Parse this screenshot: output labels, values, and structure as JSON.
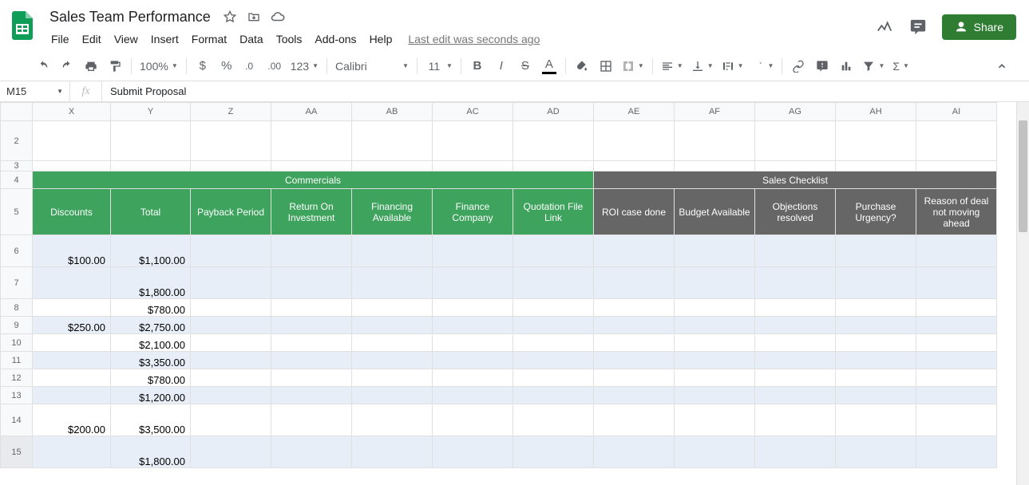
{
  "header": {
    "doc_title": "Sales Team Performance",
    "menus": [
      "File",
      "Edit",
      "View",
      "Insert",
      "Format",
      "Data",
      "Tools",
      "Add-ons",
      "Help"
    ],
    "last_edit": "Last edit was seconds ago",
    "share_label": "Share"
  },
  "toolbar": {
    "zoom": "100%",
    "font_name": "Calibri",
    "font_size": "11",
    "number_fmt": "123"
  },
  "formula_bar": {
    "name_box": "M15",
    "formula": "Submit Proposal"
  },
  "columns": [
    "X",
    "Y",
    "Z",
    "AA",
    "AB",
    "AC",
    "AD",
    "AE",
    "AF",
    "AG",
    "AH",
    "AI"
  ],
  "row_numbers": [
    "2",
    "3",
    "4",
    "5",
    "6",
    "7",
    "8",
    "9",
    "10",
    "11",
    "12",
    "13",
    "14",
    "15"
  ],
  "section_headers": {
    "commercials": "Commercials",
    "sales_checklist": "Sales Checklist"
  },
  "sub_headers_green": [
    "Discounts",
    "Total",
    "Payback Period",
    "Return On Investment",
    "Financing Available",
    "Finance Company",
    "Quotation File Link"
  ],
  "sub_headers_gray": [
    "ROI case done",
    "Budget Available",
    "Objections resolved",
    "Purchase Urgency?",
    "Reason of deal not moving ahead"
  ],
  "rows": [
    {
      "discount": "$100.00",
      "total": "$1,100.00",
      "alt": true,
      "tall": true
    },
    {
      "discount": "",
      "total": "$1,800.00",
      "alt": true,
      "tall": true
    },
    {
      "discount": "",
      "total": "$780.00",
      "alt": false,
      "tall": false
    },
    {
      "discount": "$250.00",
      "total": "$2,750.00",
      "alt": true,
      "tall": false
    },
    {
      "discount": "",
      "total": "$2,100.00",
      "alt": false,
      "tall": false
    },
    {
      "discount": "",
      "total": "$3,350.00",
      "alt": true,
      "tall": false
    },
    {
      "discount": "",
      "total": "$780.00",
      "alt": false,
      "tall": false
    },
    {
      "discount": "",
      "total": "$1,200.00",
      "alt": true,
      "tall": false
    },
    {
      "discount": "$200.00",
      "total": "$3,500.00",
      "alt": false,
      "tall": true
    },
    {
      "discount": "",
      "total": "$1,800.00",
      "alt": true,
      "tall": true
    }
  ],
  "selected_row_idx": 9
}
